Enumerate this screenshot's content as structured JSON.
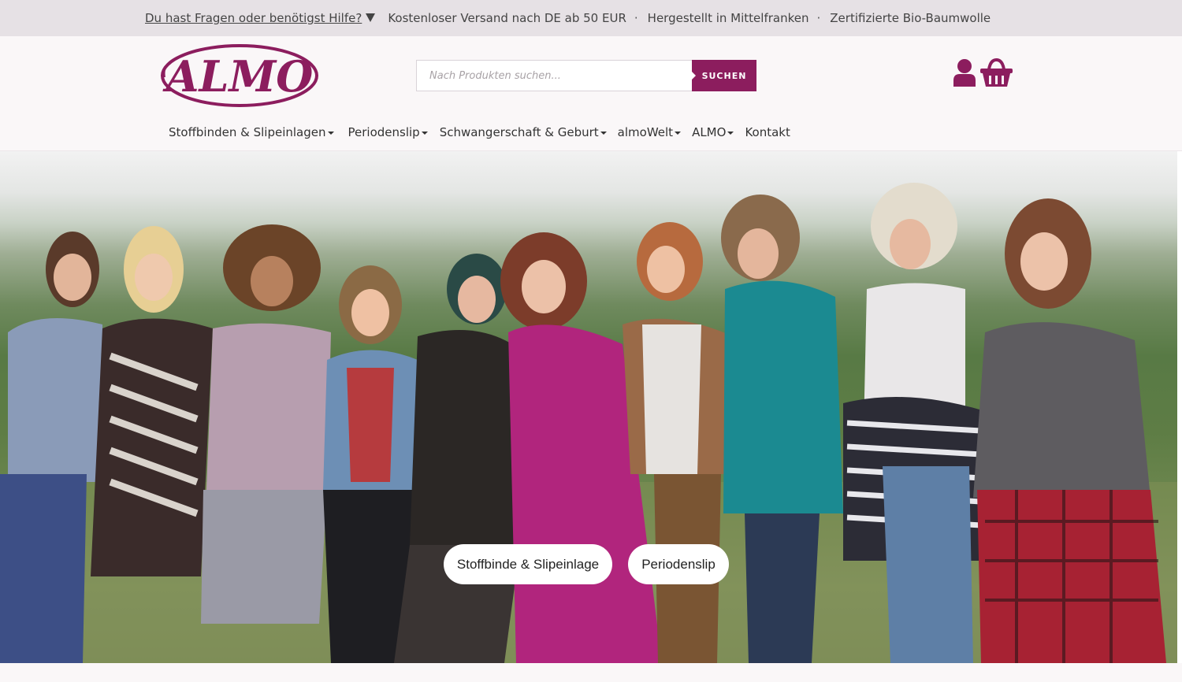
{
  "topbar": {
    "help_link": "Du hast Fragen oder benötigst Hilfe?",
    "items": [
      "Kostenloser Versand nach DE ab 50 EUR",
      "Hergestellt in Mittelfranken",
      "Zertifizierte Bio-Baumwolle"
    ],
    "separator": "·"
  },
  "header": {
    "logo_text": "ALMO",
    "search": {
      "placeholder": "Nach Produkten suchen...",
      "button_label": "SUCHEN"
    },
    "icons": [
      "account-icon",
      "cart-icon"
    ]
  },
  "nav": {
    "items": [
      {
        "label": "Stoffbinden & Slipeinlagen",
        "dropdown": true
      },
      {
        "label": "Periodenslip",
        "dropdown": true
      },
      {
        "label": "Schwangerschaft & Geburt",
        "dropdown": true
      },
      {
        "label": "almoWelt",
        "dropdown": true
      },
      {
        "label": "ALMO",
        "dropdown": true
      },
      {
        "label": "Kontakt",
        "dropdown": false
      }
    ]
  },
  "hero": {
    "buttons": [
      "Stoffbinde & Slipeinlage",
      "Periodenslip"
    ]
  },
  "colors": {
    "brand": "#8c1d5e",
    "topbar_bg": "#e6e1e5",
    "header_bg": "#faf7f8"
  }
}
